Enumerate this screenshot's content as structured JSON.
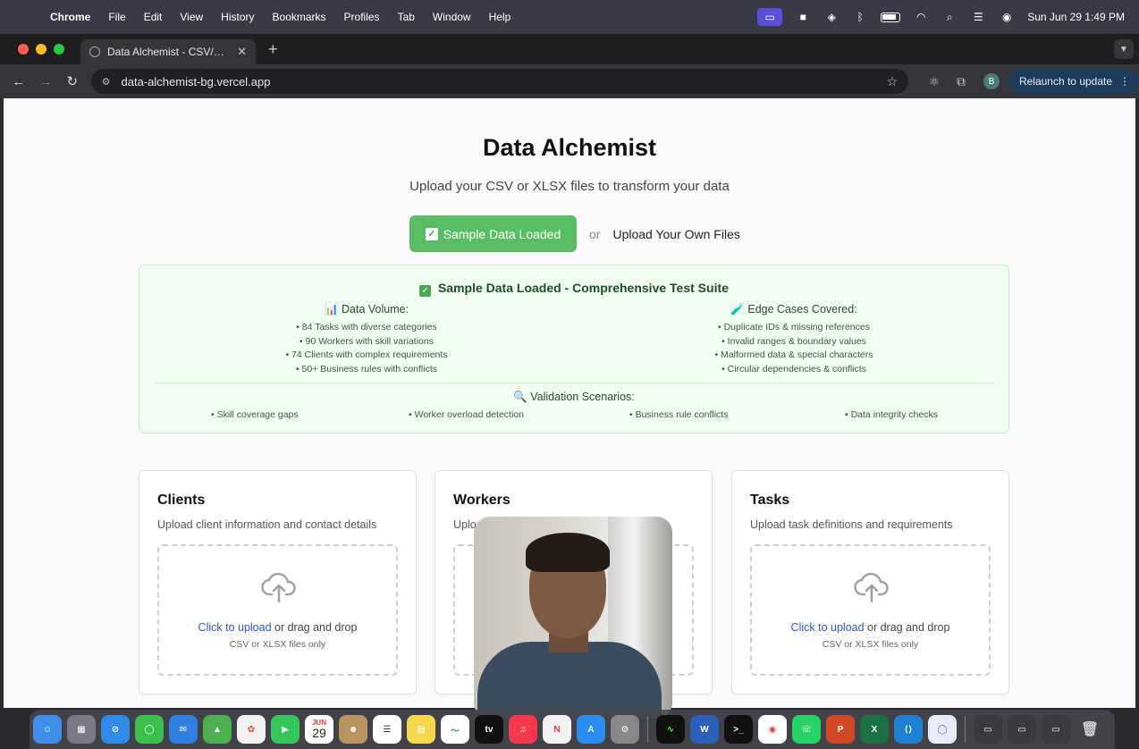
{
  "menubar": {
    "app_name": "Chrome",
    "items": [
      "File",
      "Edit",
      "View",
      "History",
      "Bookmarks",
      "Profiles",
      "Tab",
      "Window",
      "Help"
    ],
    "datetime": "Sun Jun 29  1:49 PM"
  },
  "browser": {
    "tab_title": "Data Alchemist - CSV/XLSX Validator",
    "url": "data-alchemist-bg.vercel.app",
    "profile_initial": "B",
    "relaunch_label": "Relaunch to update"
  },
  "page": {
    "title": "Data Alchemist",
    "subtitle": "Upload your CSV or XLSX files to transform your data",
    "sample_button": "Sample Data Loaded",
    "or_text": "or",
    "upload_own": "Upload Your Own Files",
    "panel": {
      "title": "Sample Data Loaded - Comprehensive Test Suite",
      "data_volume_heading": "📊 Data Volume:",
      "data_volume": [
        "• 84 Tasks with diverse categories",
        "• 90 Workers with skill variations",
        "• 74 Clients with complex requirements",
        "• 50+ Business rules with conflicts"
      ],
      "edge_cases_heading": "🧪 Edge Cases Covered:",
      "edge_cases": [
        "• Duplicate IDs & missing references",
        "• Invalid ranges & boundary values",
        "• Malformed data & special characters",
        "• Circular dependencies & conflicts"
      ],
      "validation_heading": "🔍 Validation Scenarios:",
      "validation_scenarios": [
        "• Skill coverage gaps",
        "• Worker overload detection",
        "• Business rule conflicts",
        "• Data integrity checks"
      ]
    },
    "cards": [
      {
        "title": "Clients",
        "description": "Upload client information and contact details",
        "click_to_upload": "Click to upload",
        "drag_text": " or drag and drop",
        "file_types": "CSV or XLSX files only"
      },
      {
        "title": "Workers",
        "description": "Upload",
        "click_to_upload": "",
        "drag_text": "",
        "file_types": ""
      },
      {
        "title": "Tasks",
        "description": "Upload task definitions and requirements",
        "click_to_upload": "Click to upload",
        "drag_text": " or drag and drop",
        "file_types": "CSV or XLSX files only"
      }
    ]
  },
  "dock": {
    "calendar_month": "JUN",
    "calendar_day": "29",
    "tv_label": "tv"
  },
  "colors": {
    "accent_green": "#5bbd63",
    "link_blue": "#2f56d8",
    "panel_bg": "#f0fbf1"
  }
}
